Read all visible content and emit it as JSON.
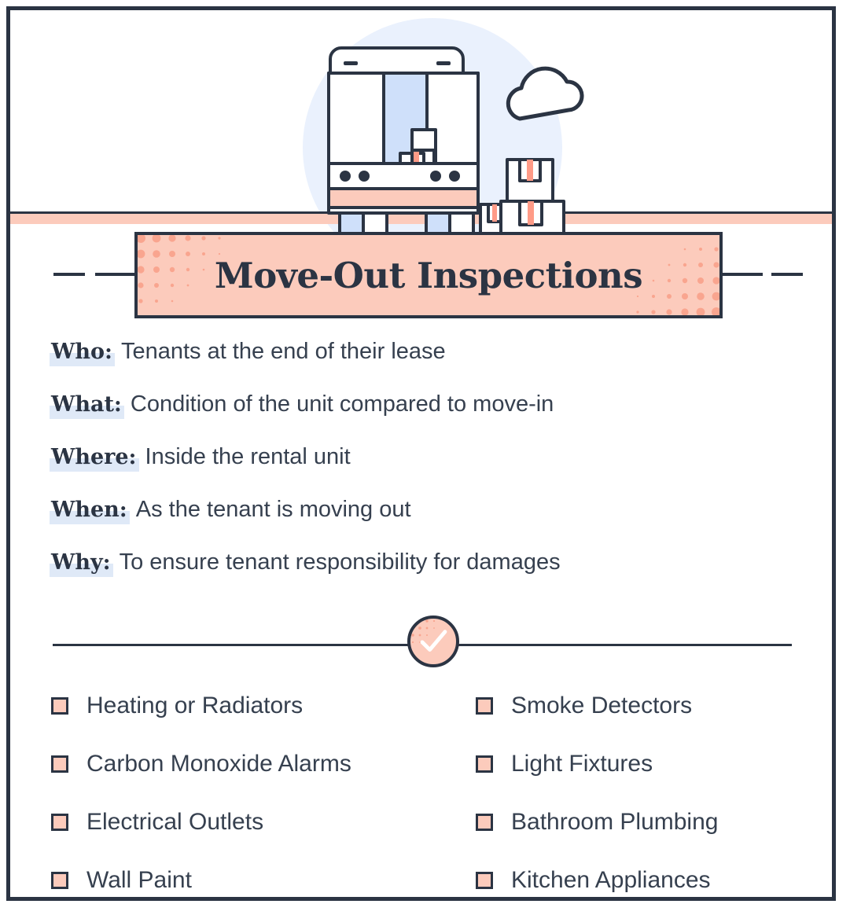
{
  "card": {
    "border_color": "#2b3443",
    "background": "#ffffff"
  },
  "illustration": {
    "name": "moving-truck-with-boxes-illustration",
    "elements": [
      "moving-truck",
      "cloud",
      "cardboard-boxes",
      "pale-blue-circle-backdrop",
      "ground-line"
    ],
    "colors": {
      "outline": "#2b3443",
      "peach": "#fccbbc",
      "tape": "#ff9b87",
      "pale_blue": "#eaf1fd",
      "panel_blue": "#cfe0fa",
      "white": "#ffffff"
    }
  },
  "banner": {
    "title": "Move-Out Inspections",
    "background": "#fccbbc",
    "border_color": "#2b3443",
    "halftone_color": "#f9a58f"
  },
  "details": {
    "items": [
      {
        "label": "Who:",
        "text": "Tenants at the end of their lease"
      },
      {
        "label": "What:",
        "text": "Condition of the unit compared to move-in"
      },
      {
        "label": "Where:",
        "text": "Inside the rental unit"
      },
      {
        "label": "When:",
        "text": "As the tenant is moving out"
      },
      {
        "label": "Why:",
        "text": "To ensure tenant responsibility for damages"
      }
    ],
    "highlight_color": "#dfe9f7",
    "label_color": "#2b3443",
    "text_color": "#36404f"
  },
  "divider": {
    "badge_icon": "check-circle-icon",
    "badge_fill": "#fccbbc",
    "line_color": "#2b3443"
  },
  "checklist": {
    "checkbox_fill": "#fccbbc",
    "checkbox_border": "#2b3443",
    "left_column": [
      "Heating or Radiators",
      "Carbon Monoxide Alarms",
      "Electrical Outlets",
      "Wall Paint"
    ],
    "right_column": [
      "Smoke Detectors",
      "Light Fixtures",
      "Bathroom Plumbing",
      "Kitchen Appliances"
    ]
  }
}
